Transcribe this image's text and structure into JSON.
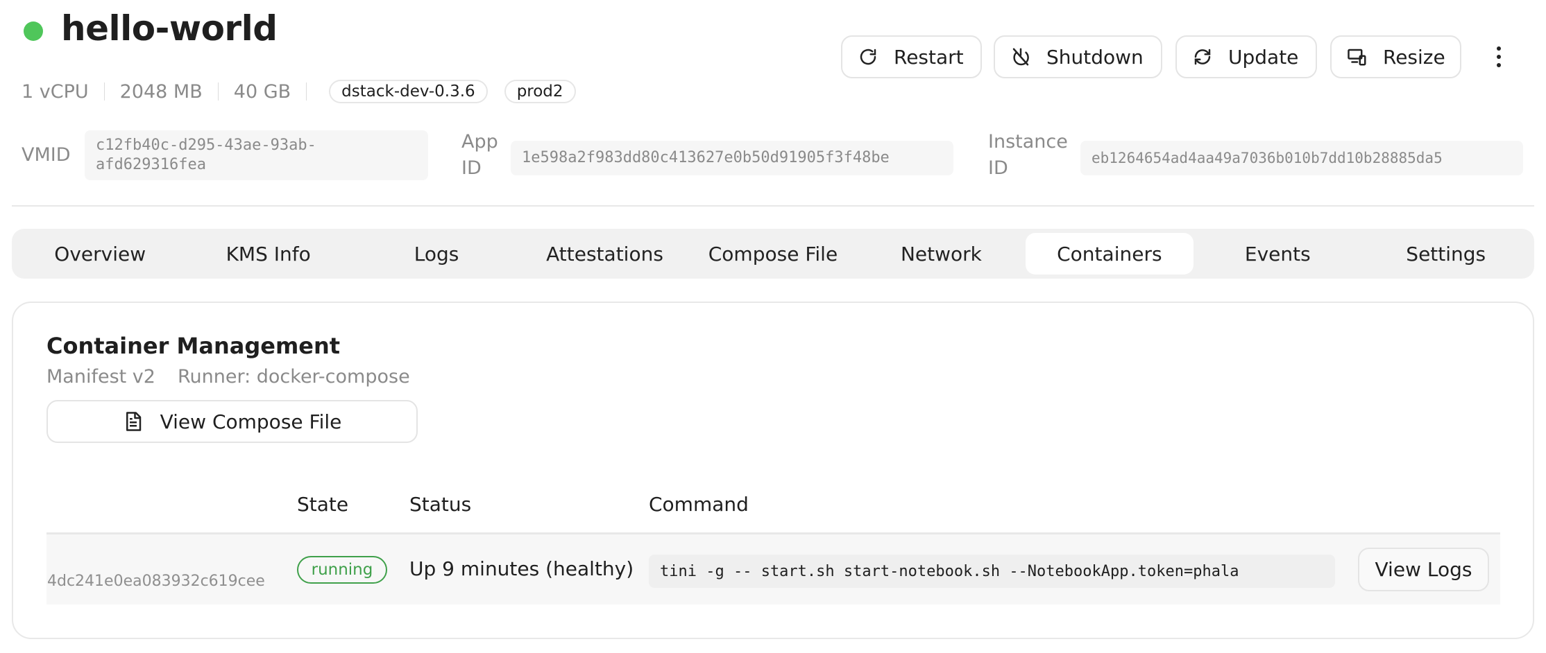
{
  "header": {
    "title": "hello-world",
    "status_color": "#4fc65a",
    "vcpu": "1 vCPU",
    "memory": "2048 MB",
    "disk": "40 GB",
    "tags": [
      "dstack-dev-0.3.6",
      "prod2"
    ]
  },
  "actions": {
    "restart": "Restart",
    "shutdown": "Shutdown",
    "update": "Update",
    "resize": "Resize"
  },
  "ids": {
    "vmid_label": "VMID",
    "vmid": "c12fb40c-d295-43ae-93ab-afd629316fea",
    "app_label": "App ID",
    "app": "1e598a2f983dd80c413627e0b50d91905f3f48be",
    "instance_label": "Instance ID",
    "instance": "eb1264654ad4aa49a7036b010b7dd10b28885da5"
  },
  "tabs": [
    {
      "label": "Overview"
    },
    {
      "label": "KMS Info"
    },
    {
      "label": "Logs"
    },
    {
      "label": "Attestations"
    },
    {
      "label": "Compose File"
    },
    {
      "label": "Network"
    },
    {
      "label": "Containers",
      "active": true
    },
    {
      "label": "Events"
    },
    {
      "label": "Settings"
    }
  ],
  "containers": {
    "title": "Container Management",
    "manifest": "Manifest v2",
    "runner": "Runner: docker-compose",
    "view_compose": "View Compose File",
    "columns": {
      "state": "State",
      "status": "Status",
      "command": "Command"
    },
    "rows": [
      {
        "id": "4dc241e0ea083932c619cee",
        "state": "running",
        "status": "Up 9 minutes (healthy)",
        "command": "tini -g -- start.sh start-notebook.sh --NotebookApp.token=phala",
        "action": "View Logs"
      }
    ],
    "state_color": "#3fa04a"
  }
}
